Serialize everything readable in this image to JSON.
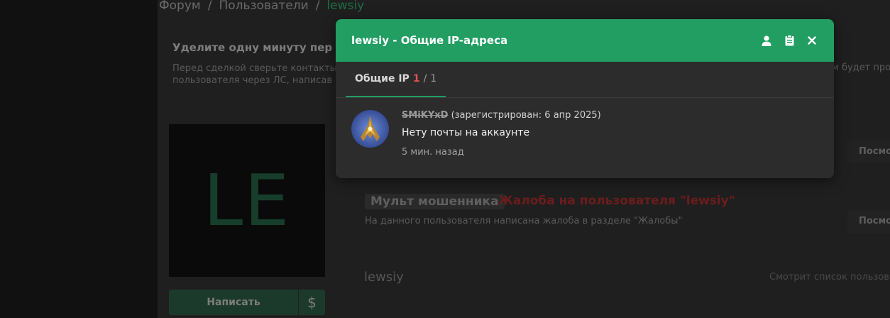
{
  "background": {
    "breadcrumb": [
      "Форум",
      "Пользователи",
      "lewsiy"
    ],
    "notice_title": "Уделите одну минуту пер",
    "notice_text": "Перед сделкой сверьте контакты пользователя через ЛС, написав",
    "notice_text_right": "м будет про",
    "avatar_letters": "LE",
    "write_button": "Написать",
    "dollar_button": "$",
    "tag": "Мульт мошенника",
    "complaint_title": "Жалоба на пользователя \"lewsiy\"",
    "complaint_text": "На данного пользователя написана жалоба в разделе \"Жалобы\"",
    "view_button": "Посмо",
    "username": "lewsiy",
    "watching": "Смотрит список пользов"
  },
  "modal": {
    "title": "lewsiy - Общие IP-адреса",
    "icons": [
      "user-icon",
      "clipboard-icon",
      "close-icon"
    ],
    "tab": {
      "label": "Общие IP",
      "count_current": "1",
      "separator": "/",
      "count_total": "1"
    },
    "entry": {
      "username": "SMiKYxD",
      "registered": "(зарегистрирован: 6 апр 2025)",
      "note": "Нету почты на аккаунте",
      "time": "5 мин. назад"
    }
  },
  "colors": {
    "accent": "#229e62",
    "counter_red": "#e05252"
  }
}
